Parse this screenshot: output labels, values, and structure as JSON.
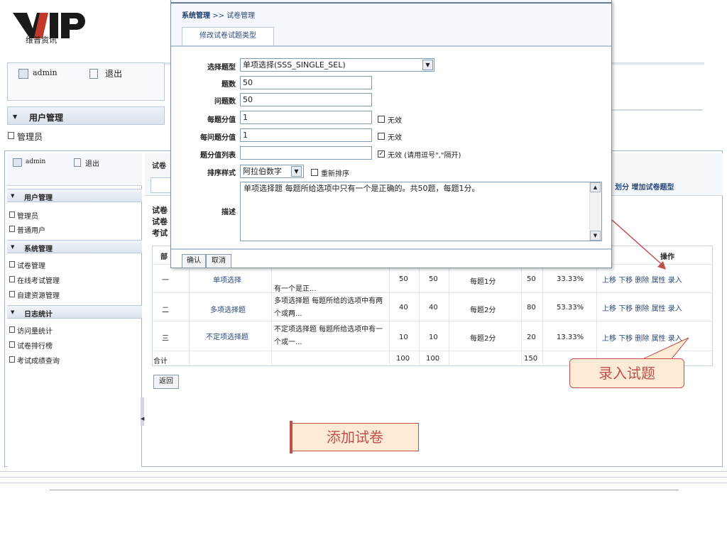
{
  "logo": {
    "subtitle": "维普资讯"
  },
  "bg_window": {
    "user": "admin",
    "logout": "退出",
    "section": "用户管理",
    "item": "管理员"
  },
  "sidebar": {
    "user": "admin",
    "logout": "退出",
    "sections": [
      {
        "title": "用户管理",
        "items": [
          "管理员",
          "普通用户"
        ]
      },
      {
        "title": "系统管理",
        "items": [
          "试卷管理",
          "在线考试管理",
          "自建资源管理"
        ]
      },
      {
        "title": "日志统计",
        "items": [
          "访问量统计",
          "试卷排行榜",
          "考试成绩查询"
        ]
      }
    ]
  },
  "content": {
    "title": "试卷",
    "head_actions": "划分 增加试卷题型",
    "info_lines": [
      "试卷",
      "试卷",
      "考试"
    ],
    "table": {
      "header_seq": "部",
      "header_op": "操作",
      "rows": [
        {
          "seq": "一",
          "type": "单项选择",
          "desc": "有一个是正...",
          "n1": "50",
          "n2": "50",
          "score": "每题1分",
          "total": "50",
          "pct": "33.33%"
        },
        {
          "seq": "二",
          "type": "多项选择题",
          "desc": "多项选择题 每题所给的选项中有两个或两...",
          "n1": "40",
          "n2": "40",
          "score": "每题2分",
          "total": "80",
          "pct": "53.33%"
        },
        {
          "seq": "三",
          "type": "不定项选择题",
          "desc": "不定项选择题 每题所给选项中有一个或一...",
          "n1": "10",
          "n2": "10",
          "score": "每题2分",
          "total": "20",
          "pct": "13.33%"
        }
      ],
      "sum_label": "合计",
      "sum_n1": "100",
      "sum_n2": "100",
      "sum_total": "150",
      "row_ops": [
        "上移",
        "下移",
        "删除",
        "属性",
        "录入"
      ]
    },
    "back": "返回"
  },
  "dialog": {
    "breadcrumb_root": "系统管理",
    "breadcrumb_sep": ">>",
    "breadcrumb_page": "试卷管理",
    "tab": "修改试卷试题类型",
    "fields": {
      "type_label": "选择题型",
      "type_value": "单项选择(SSS_SINGLE_SEL)",
      "count_label": "题数",
      "count_value": "50",
      "qcount_label": "问题数",
      "qcount_value": "50",
      "score_label": "每题分值",
      "score_value": "1",
      "score_none": "无效",
      "qscore_label": "每问题分值",
      "qscore_value": "1",
      "qscore_none": "无效",
      "list_label": "题分值列表",
      "list_value": "",
      "list_none": "无效 (请用逗号\",\"隔开)",
      "order_label": "排序样式",
      "order_value": "阿拉伯数字",
      "reorder": "重新排序",
      "desc_label": "描述",
      "desc_value": "单项选择题  每题所给选项中只有一个是正确的。共50题，每题1分。"
    },
    "confirm": "确认",
    "cancel": "取消"
  },
  "callouts": {
    "enter": "录入试题",
    "add": "添加试卷"
  },
  "colors": {
    "accent": "#c0504d",
    "callout_bg": "#fdebd6",
    "link": "#2b4a78"
  }
}
